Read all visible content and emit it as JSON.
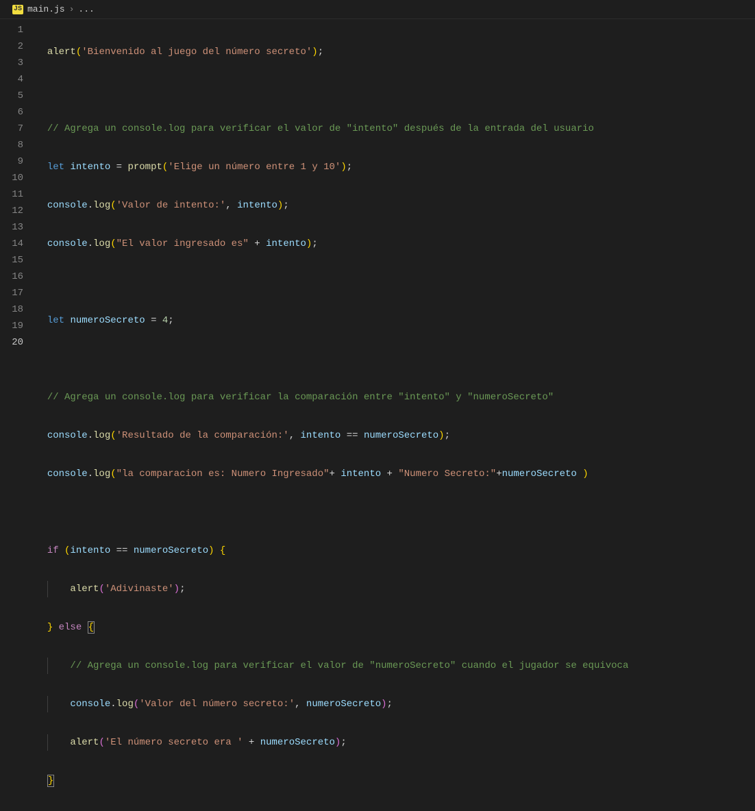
{
  "breadcrumb": {
    "icon": "JS",
    "filename": "main.js",
    "separator": "›",
    "context": "..."
  },
  "lineNumbers": [
    "1",
    "2",
    "3",
    "4",
    "5",
    "6",
    "7",
    "8",
    "9",
    "10",
    "11",
    "12",
    "13",
    "14",
    "15",
    "16",
    "17",
    "18",
    "19",
    "20"
  ],
  "code": {
    "l1": {
      "fn": "alert",
      "str": "'Bienvenido al juego del número secreto'"
    },
    "l3": {
      "cmt": "// Agrega un console.log para verificar el valor de \"intento\" después de la entrada del usuario"
    },
    "l4": {
      "kw": "let",
      "var": "intento",
      "fn": "prompt",
      "str": "'Elige un número entre 1 y 10'"
    },
    "l5": {
      "obj": "console",
      "fn": "log",
      "str": "'Valor de intento:'",
      "var": "intento"
    },
    "l6": {
      "obj": "console",
      "fn": "log",
      "str": "\"El valor ingresado es\"",
      "var": "intento"
    },
    "l8": {
      "kw": "let",
      "var": "numeroSecreto",
      "num": "4"
    },
    "l10": {
      "cmt": "// Agrega un console.log para verificar la comparación entre \"intento\" y \"numeroSecreto\""
    },
    "l11": {
      "obj": "console",
      "fn": "log",
      "str": "'Resultado de la comparación:'",
      "var1": "intento",
      "var2": "numeroSecreto"
    },
    "l12": {
      "obj": "console",
      "fn": "log",
      "str1": "\"la comparacion es: Numero Ingresado\"",
      "var1": "intento",
      "str2": "\"Numero Secreto:\"",
      "var2": "numeroSecreto"
    },
    "l14": {
      "ctrl": "if",
      "var1": "intento",
      "var2": "numeroSecreto"
    },
    "l15": {
      "fn": "alert",
      "str": "'Adivinaste'"
    },
    "l16": {
      "ctrl": "else"
    },
    "l17": {
      "cmt": "// Agrega un console.log para verificar el valor de \"numeroSecreto\" cuando el jugador se equivoca"
    },
    "l18": {
      "obj": "console",
      "fn": "log",
      "str": "'Valor del número secreto:'",
      "var": "numeroSecreto"
    },
    "l19": {
      "fn": "alert",
      "str": "'El número secreto era '",
      "var": "numeroSecreto"
    }
  }
}
